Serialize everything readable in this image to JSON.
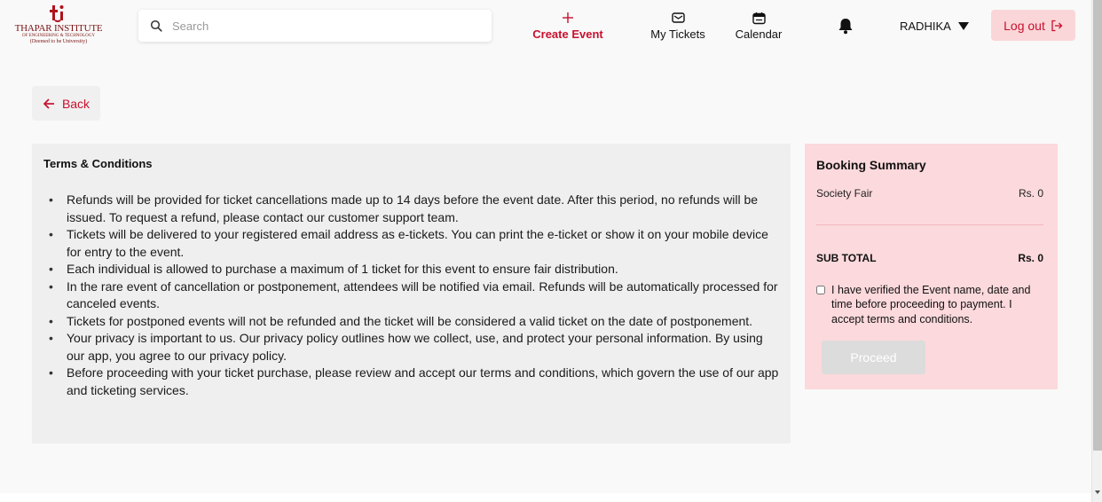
{
  "header": {
    "logo": {
      "name": "THAPAR INSTITUTE",
      "sub": "OF ENGINEERING & TECHNOLOGY",
      "sub2": "(Deemed to be University)",
      "brand_color": "#7a1212"
    },
    "search": {
      "placeholder": "Search",
      "value": ""
    },
    "nav": {
      "create_event": "Create Event",
      "my_tickets": "My Tickets",
      "calendar": "Calendar"
    },
    "user_name": "RADHIKA",
    "logout_label": "Log out",
    "accent_color": "#c8102e"
  },
  "back_label": "Back",
  "terms": {
    "title": "Terms & Conditions",
    "items": [
      "Refunds will be provided for ticket cancellations made up to 14 days before the event date. After this period, no refunds will be issued. To request a refund, please contact our customer support team.",
      "Tickets will be delivered to your registered email address as e-tickets. You can print the e-ticket or show it on your mobile device for entry to the event.",
      "Each individual is allowed to purchase a maximum of 1 ticket for this event to ensure fair distribution.",
      "In the rare event of cancellation or postponement, attendees will be notified via email. Refunds will be automatically processed for canceled events.",
      "Tickets for postponed events will not be refunded and the ticket will be considered a valid ticket on the date of postponement.",
      "Your privacy is important to us. Our privacy policy outlines how we collect, use, and protect your personal information. By using our app, you agree to our privacy policy.",
      "Before proceeding with your ticket purchase, please review and accept our terms and conditions, which govern the use of our app and ticketing services."
    ]
  },
  "summary": {
    "title": "Booking Summary",
    "item_name": "Society Fair",
    "item_price": "Rs. 0",
    "subtotal_label": "SUB TOTAL",
    "subtotal_value": "Rs. 0",
    "agree_text": "I have verified the Event name, date and time before proceeding to payment. I accept terms and conditions.",
    "agree_checked": false,
    "proceed_label": "Proceed",
    "panel_color": "#fcd9dc"
  }
}
